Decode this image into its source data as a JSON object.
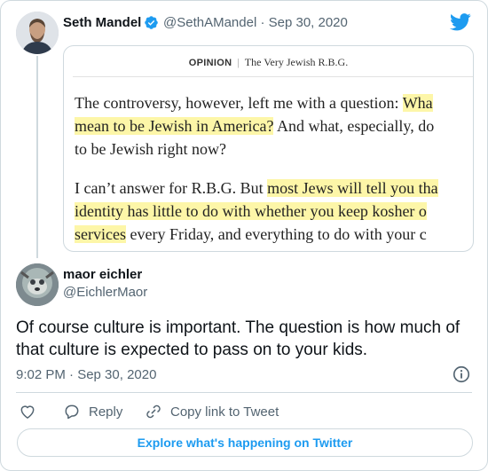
{
  "quoted_tweet": {
    "author_name": "Seth Mandel",
    "handle_line": "@SethAMandel · Sep 30, 2020",
    "article": {
      "section": "OPINION",
      "title": "The Very Jewish R.B.G.",
      "para1": [
        {
          "pre": "The controversy, however, left me with a question: ",
          "hl": "Wha"
        },
        {
          "pre": "",
          "hl": "mean to be Jewish in America?",
          "post": " And what, especially, do"
        },
        {
          "pre": "to be Jewish right now?"
        }
      ],
      "para2": [
        {
          "pre": "I can’t answer for R.B.G. But ",
          "hl": "most Jews will tell you tha"
        },
        {
          "pre": "",
          "hl": "identity has little to do with whether you keep kosher o"
        },
        {
          "pre": "",
          "hl": "services",
          "post": " every Friday, and everything to do with your c"
        }
      ]
    }
  },
  "reply": {
    "author_name": "maor eichler",
    "handle": "@EichlerMaor",
    "text": "Of course culture is important. The question is how much of that culture is expected to pass on to your kids.",
    "timestamp": "9:02 PM · Sep 30, 2020"
  },
  "actions": {
    "reply_label": "Reply",
    "copy_label": "Copy link to Tweet"
  },
  "explore_label": "Explore what's happening on Twitter",
  "colors": {
    "accent": "#1d9bf0",
    "secondary_text": "#536471",
    "border": "#cfd9de",
    "highlight": "#fdf6a8"
  }
}
